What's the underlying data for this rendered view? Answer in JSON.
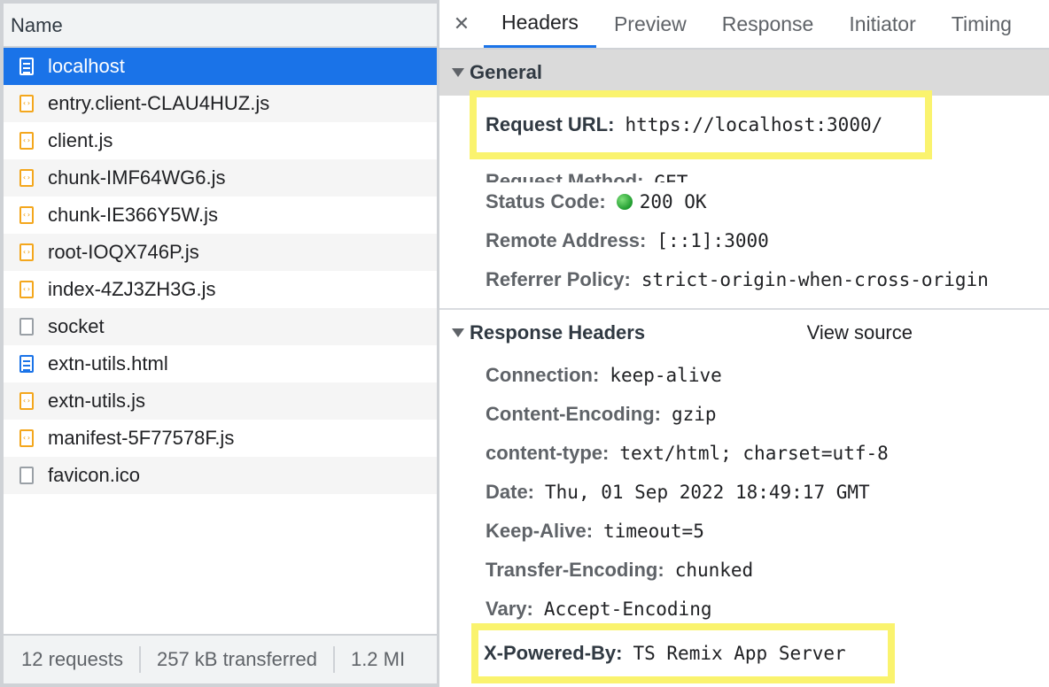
{
  "request_list": {
    "column_header": "Name",
    "items": [
      {
        "name": "localhost",
        "type": "doc",
        "selected": true
      },
      {
        "name": "entry.client-CLAU4HUZ.js",
        "type": "script"
      },
      {
        "name": "client.js",
        "type": "script"
      },
      {
        "name": "chunk-IMF64WG6.js",
        "type": "script"
      },
      {
        "name": "chunk-IE366Y5W.js",
        "type": "script"
      },
      {
        "name": "root-IOQX746P.js",
        "type": "script"
      },
      {
        "name": "index-4ZJ3ZH3G.js",
        "type": "script"
      },
      {
        "name": "socket",
        "type": "other"
      },
      {
        "name": "extn-utils.html",
        "type": "doc"
      },
      {
        "name": "extn-utils.js",
        "type": "script"
      },
      {
        "name": "manifest-5F77578F.js",
        "type": "script"
      },
      {
        "name": "favicon.ico",
        "type": "other"
      }
    ],
    "script_icon_glyph": "‹›"
  },
  "status_bar": {
    "requests": "12 requests",
    "transferred": "257 kB transferred",
    "resources": "1.2 MI"
  },
  "details": {
    "close_glyph": "✕",
    "tabs": {
      "headers": "Headers",
      "preview": "Preview",
      "response": "Response",
      "initiator": "Initiator",
      "timing": "Timing"
    },
    "general": {
      "title": "General",
      "request_url_key": "Request URL:",
      "request_url_value": "https://localhost:3000/",
      "request_method_key": "Request Method:",
      "request_method_value": "GET",
      "status_code_key": "Status Code:",
      "status_code_value": "200 OK",
      "remote_address_key": "Remote Address:",
      "remote_address_value": "[::1]:3000",
      "referrer_policy_key": "Referrer Policy:",
      "referrer_policy_value": "strict-origin-when-cross-origin"
    },
    "response_headers": {
      "title": "Response Headers",
      "view_source": "View source",
      "connection_key": "Connection:",
      "connection_value": "keep-alive",
      "content_encoding_key": "Content-Encoding:",
      "content_encoding_value": "gzip",
      "content_type_key": "content-type:",
      "content_type_value": "text/html; charset=utf-8",
      "date_key": "Date:",
      "date_value": "Thu, 01 Sep 2022 18:49:17 GMT",
      "keep_alive_key": "Keep-Alive:",
      "keep_alive_value": "timeout=5",
      "transfer_encoding_key": "Transfer-Encoding:",
      "transfer_encoding_value": "chunked",
      "vary_key": "Vary:",
      "vary_value": "Accept-Encoding",
      "x_powered_by_key": "X-Powered-By:",
      "x_powered_by_value": "TS Remix App Server"
    }
  },
  "colors": {
    "selected_row": "#1a73e8",
    "highlight": "#faf36e",
    "status_ok": "#1f9b2e",
    "script_icon": "#f4a71d",
    "doc_icon": "#1a73e8"
  }
}
